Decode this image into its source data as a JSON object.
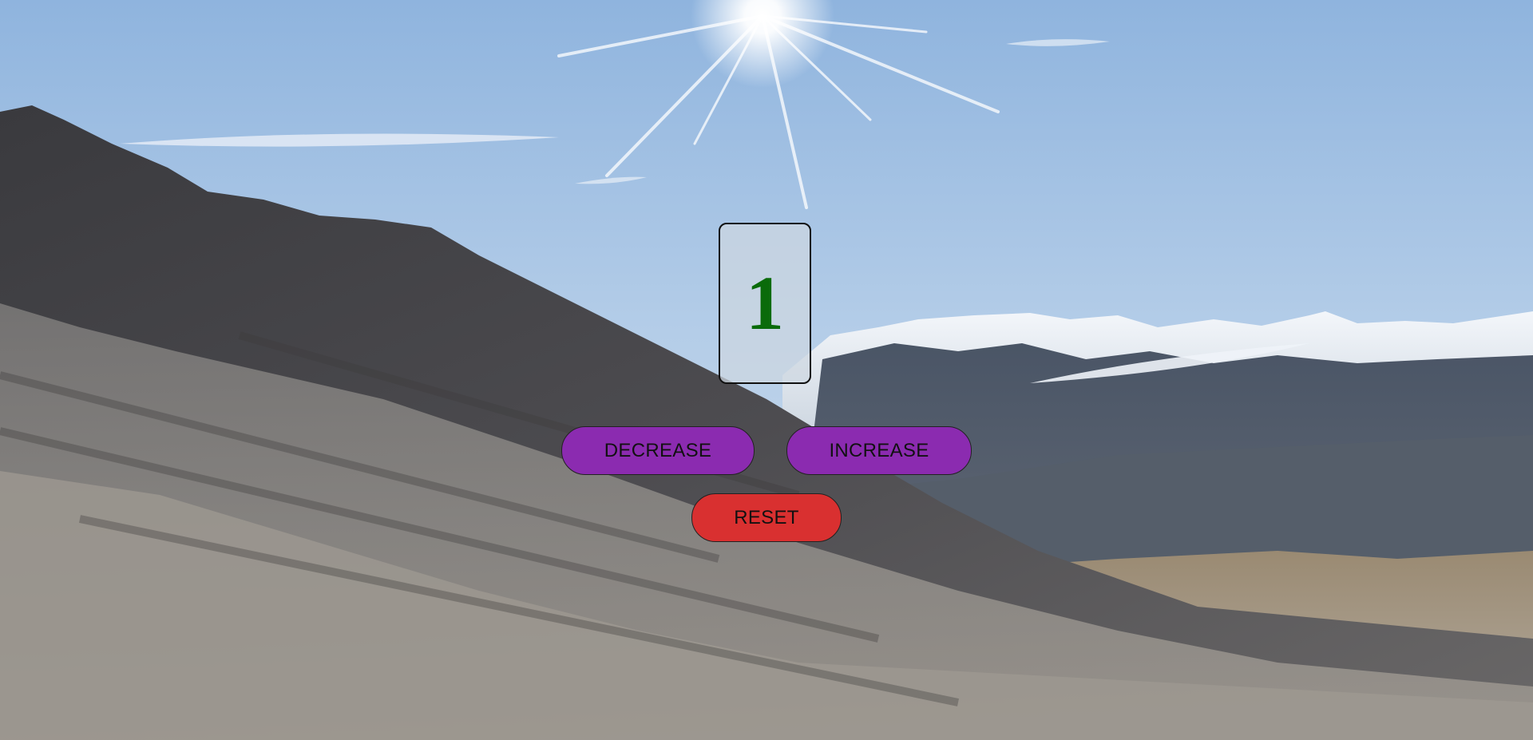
{
  "counter": {
    "value": "1",
    "value_color": "#0a6b0a"
  },
  "buttons": {
    "decrease_label": "DECREASE",
    "increase_label": "INCREASE",
    "reset_label": "RESET"
  },
  "colors": {
    "decrease_bg": "#8b2bb0",
    "increase_bg": "#8b2bb0",
    "reset_bg": "#d93030"
  },
  "background": {
    "description_icon": "mountain-landscape-background"
  }
}
